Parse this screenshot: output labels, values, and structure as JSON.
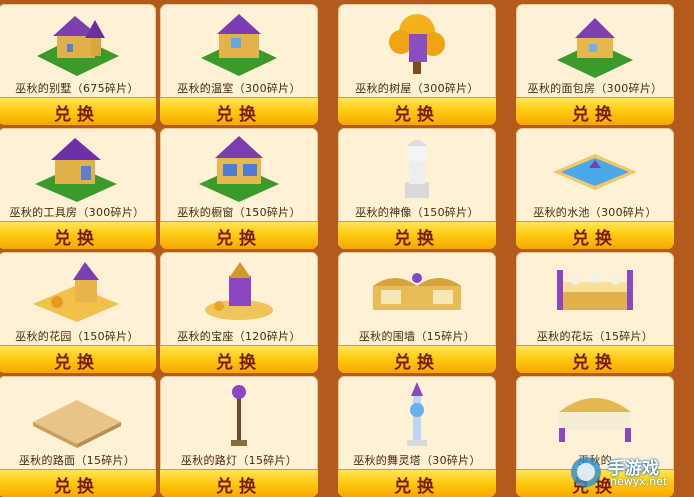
{
  "button_label": "兑换",
  "items": [
    {
      "name": "巫秋的别墅（675碎片）",
      "icon": "villa-icon"
    },
    {
      "name": "巫秋的温室（300碎片）",
      "icon": "greenhouse-icon"
    },
    {
      "name": "巫秋的树屋（300碎片）",
      "icon": "treehouse-icon"
    },
    {
      "name": "巫秋的面包房（300碎片）",
      "icon": "bakery-icon"
    },
    {
      "name": "巫秋的工具房（300碎片）",
      "icon": "toolhouse-icon"
    },
    {
      "name": "巫秋的橱窗（150碎片）",
      "icon": "showcase-icon"
    },
    {
      "name": "巫秋的神像（150碎片）",
      "icon": "statue-icon"
    },
    {
      "name": "巫秋的水池（300碎片）",
      "icon": "pool-icon"
    },
    {
      "name": "巫秋的花园（150碎片）",
      "icon": "garden-icon"
    },
    {
      "name": "巫秋的宝座（120碎片）",
      "icon": "throne-icon"
    },
    {
      "name": "巫秋的围墙（15碎片）",
      "icon": "fence-icon"
    },
    {
      "name": "巫秋的花坛（15碎片）",
      "icon": "flowerbed-icon"
    },
    {
      "name": "巫秋的路面（15碎片）",
      "icon": "pavement-icon"
    },
    {
      "name": "巫秋的路灯（15碎片）",
      "icon": "streetlamp-icon"
    },
    {
      "name": "巫秋的舞灵塔（30碎片）",
      "icon": "spirit-tower-icon"
    },
    {
      "name": "巫秋的",
      "icon": "bench-icon"
    }
  ],
  "watermark": {
    "title": "手游戏",
    "url": "newyx.net",
    "icon": "watermark-logo-icon"
  },
  "colors": {
    "background": "#b35a1c",
    "card": "#fff1d6",
    "button": "#ffcb12",
    "button_text": "#7a1b00"
  }
}
